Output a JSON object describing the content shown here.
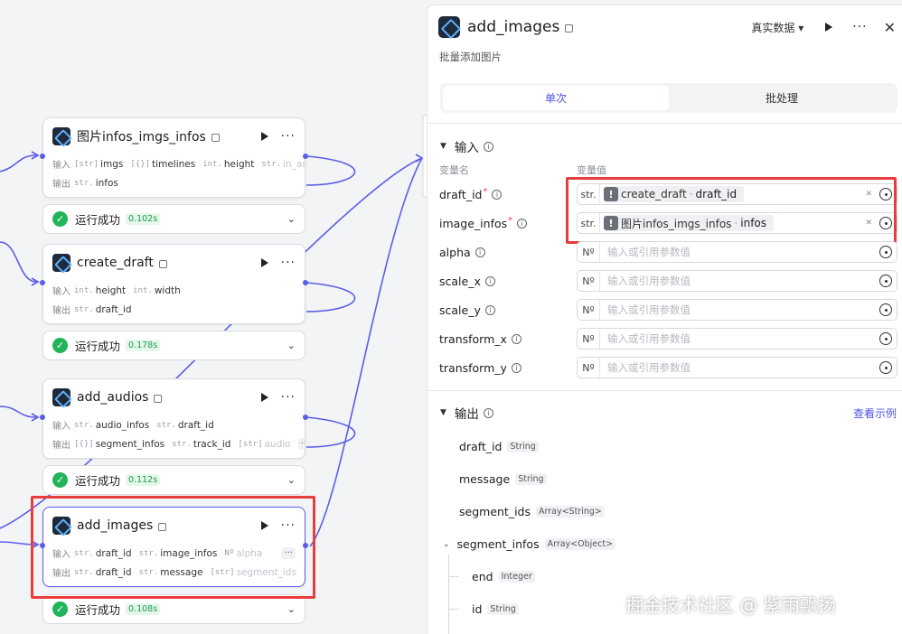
{
  "canvas": {
    "nodes": [
      {
        "title": "图片infos_imgs_infos",
        "input_label": "输入",
        "output_label": "输出",
        "inputs": [
          {
            "type": "[str]",
            "name": "imgs"
          },
          {
            "type": "[{}]",
            "name": "timelines"
          },
          {
            "type": "int.",
            "name": "height"
          },
          {
            "type": "str.",
            "name": "in_ar"
          }
        ],
        "outputs": [
          {
            "type": "str.",
            "name": "infos"
          }
        ],
        "status": "运行成功",
        "time": "0.102s"
      },
      {
        "title": "create_draft",
        "input_label": "输入",
        "output_label": "输出",
        "inputs": [
          {
            "type": "int.",
            "name": "height"
          },
          {
            "type": "int.",
            "name": "width"
          }
        ],
        "outputs": [
          {
            "type": "str.",
            "name": "draft_id"
          }
        ],
        "status": "运行成功",
        "time": "0.178s"
      },
      {
        "title": "add_audios",
        "input_label": "输入",
        "output_label": "输出",
        "inputs": [
          {
            "type": "str.",
            "name": "audio_infos"
          },
          {
            "type": "str.",
            "name": "draft_id"
          }
        ],
        "outputs": [
          {
            "type": "[{}]",
            "name": "segment_infos"
          },
          {
            "type": "str.",
            "name": "track_id"
          },
          {
            "type": "[str]",
            "name": "audio"
          }
        ],
        "status": "运行成功",
        "time": "0.112s"
      },
      {
        "title": "add_images",
        "input_label": "输入",
        "output_label": "输出",
        "inputs": [
          {
            "type": "str.",
            "name": "draft_id"
          },
          {
            "type": "str.",
            "name": "image_infos"
          },
          {
            "type": "Nº",
            "name": "alpha"
          }
        ],
        "outputs": [
          {
            "type": "str.",
            "name": "draft_id"
          },
          {
            "type": "str.",
            "name": "message"
          },
          {
            "type": "[str]",
            "name": "segment_ids"
          }
        ],
        "status": "运行成功",
        "time": "0.108s"
      }
    ],
    "more": "···"
  },
  "panel": {
    "title": "add_images",
    "subtitle": "批量添加图片",
    "mode": "真实数据",
    "tabs": [
      "单次",
      "批处理"
    ],
    "input_section": "输入",
    "col_name": "变量名",
    "col_value": "变量值",
    "params": [
      {
        "name": "draft_id",
        "required": true,
        "type": "str.",
        "ref_node": "create_draft",
        "ref_field": "draft_id"
      },
      {
        "name": "image_infos",
        "required": true,
        "type": "str.",
        "ref_node": "图片infos_imgs_infos",
        "ref_field": "infos"
      },
      {
        "name": "alpha",
        "required": false,
        "type": "Nº",
        "placeholder": "输入或引用参数值"
      },
      {
        "name": "scale_x",
        "required": false,
        "type": "Nº",
        "placeholder": "输入或引用参数值"
      },
      {
        "name": "scale_y",
        "required": false,
        "type": "Nº",
        "placeholder": "输入或引用参数值"
      },
      {
        "name": "transform_x",
        "required": false,
        "type": "Nº",
        "placeholder": "输入或引用参数值"
      },
      {
        "name": "transform_y",
        "required": false,
        "type": "Nº",
        "placeholder": "输入或引用参数值"
      }
    ],
    "output_section": "输出",
    "view_example": "查看示例",
    "outputs": [
      {
        "name": "draft_id",
        "type": "String"
      },
      {
        "name": "message",
        "type": "String"
      },
      {
        "name": "segment_ids",
        "type": "Array<String>"
      },
      {
        "name": "segment_infos",
        "type": "Array<Object>"
      },
      {
        "name": "end",
        "type": "Integer"
      },
      {
        "name": "id",
        "type": "String"
      }
    ]
  },
  "watermark": "掘金技术社区 @ 紫雨飘扬",
  "colors": {
    "accent": "#4d53e8",
    "wire": "#5a5ee6",
    "success": "#21b45a",
    "highlight": "#e83d3d"
  }
}
